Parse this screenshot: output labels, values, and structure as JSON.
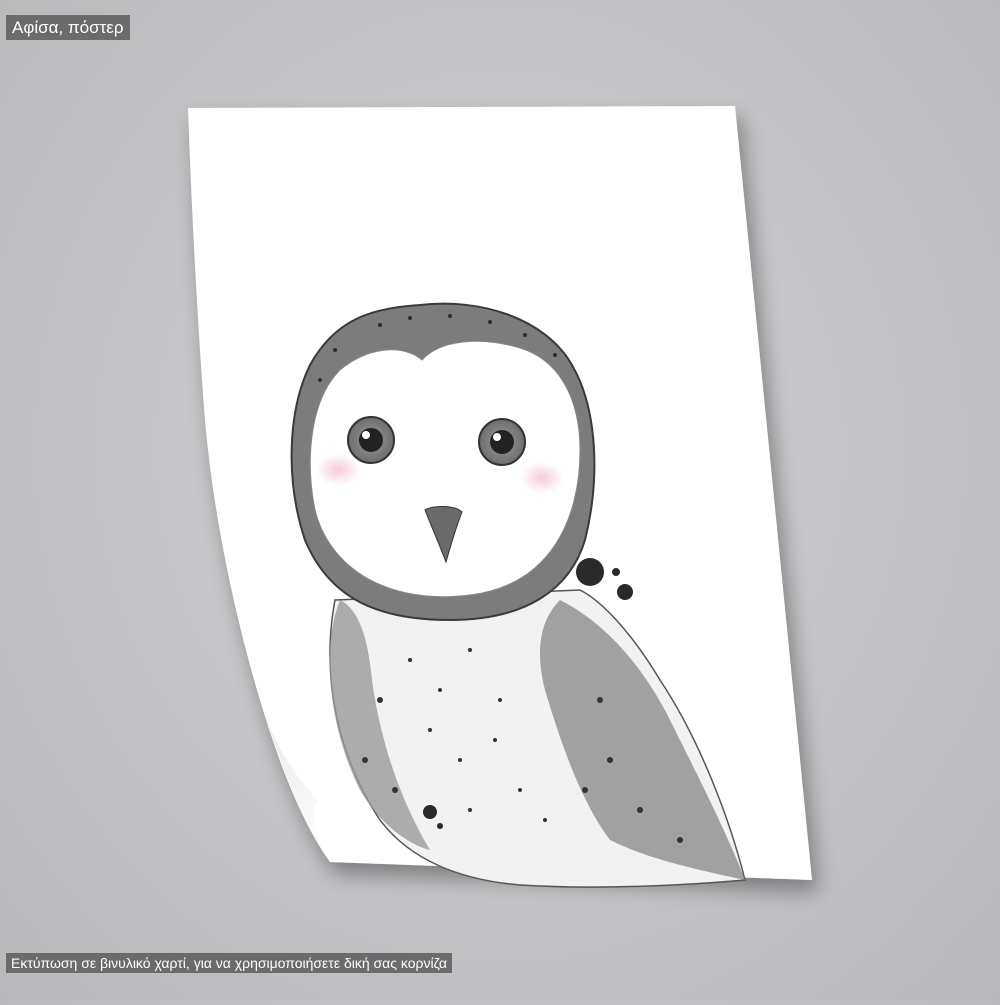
{
  "header": {
    "tag": "Αφίσα, πόστερ"
  },
  "footer": {
    "caption": "Εκτύπωση σε βινυλικό χαρτί, για να χρησιμοποιήσετε δική σας κορνίζα"
  },
  "colors": {
    "background": "#c6c6c9",
    "paper": "#ffffff",
    "label_bg": "#6b6b6b",
    "cheek": "#f3c6d3"
  },
  "poster": {
    "subject": "owl-illustration"
  }
}
